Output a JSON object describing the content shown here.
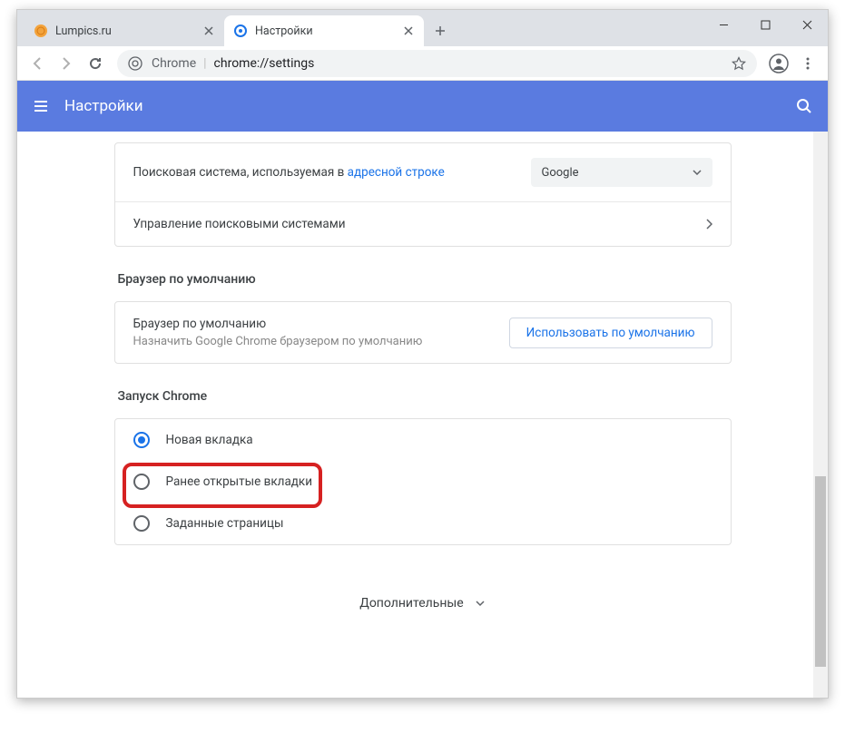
{
  "window": {
    "tabs": [
      {
        "title": "Lumpics.ru",
        "favicon": "orange-circle"
      },
      {
        "title": "Настройки",
        "favicon": "blue-gear"
      }
    ]
  },
  "address_bar": {
    "origin": "Chrome",
    "path": "chrome://settings"
  },
  "settings_header": {
    "title": "Настройки"
  },
  "search_engine": {
    "row1_prefix": "Поисковая система, используемая в ",
    "row1_link": "адресной строке",
    "dropdown_value": "Google",
    "row2_label": "Управление поисковыми системами"
  },
  "default_browser": {
    "section_title": "Браузер по умолчанию",
    "title": "Браузер по умолчанию",
    "subtitle": "Назначить Google Chrome браузером по умолчанию",
    "button": "Использовать по умолчанию"
  },
  "startup": {
    "section_title": "Запуск Chrome",
    "options": [
      "Новая вкладка",
      "Ранее открытые вкладки",
      "Заданные страницы"
    ]
  },
  "more": {
    "label": "Дополнительные"
  }
}
